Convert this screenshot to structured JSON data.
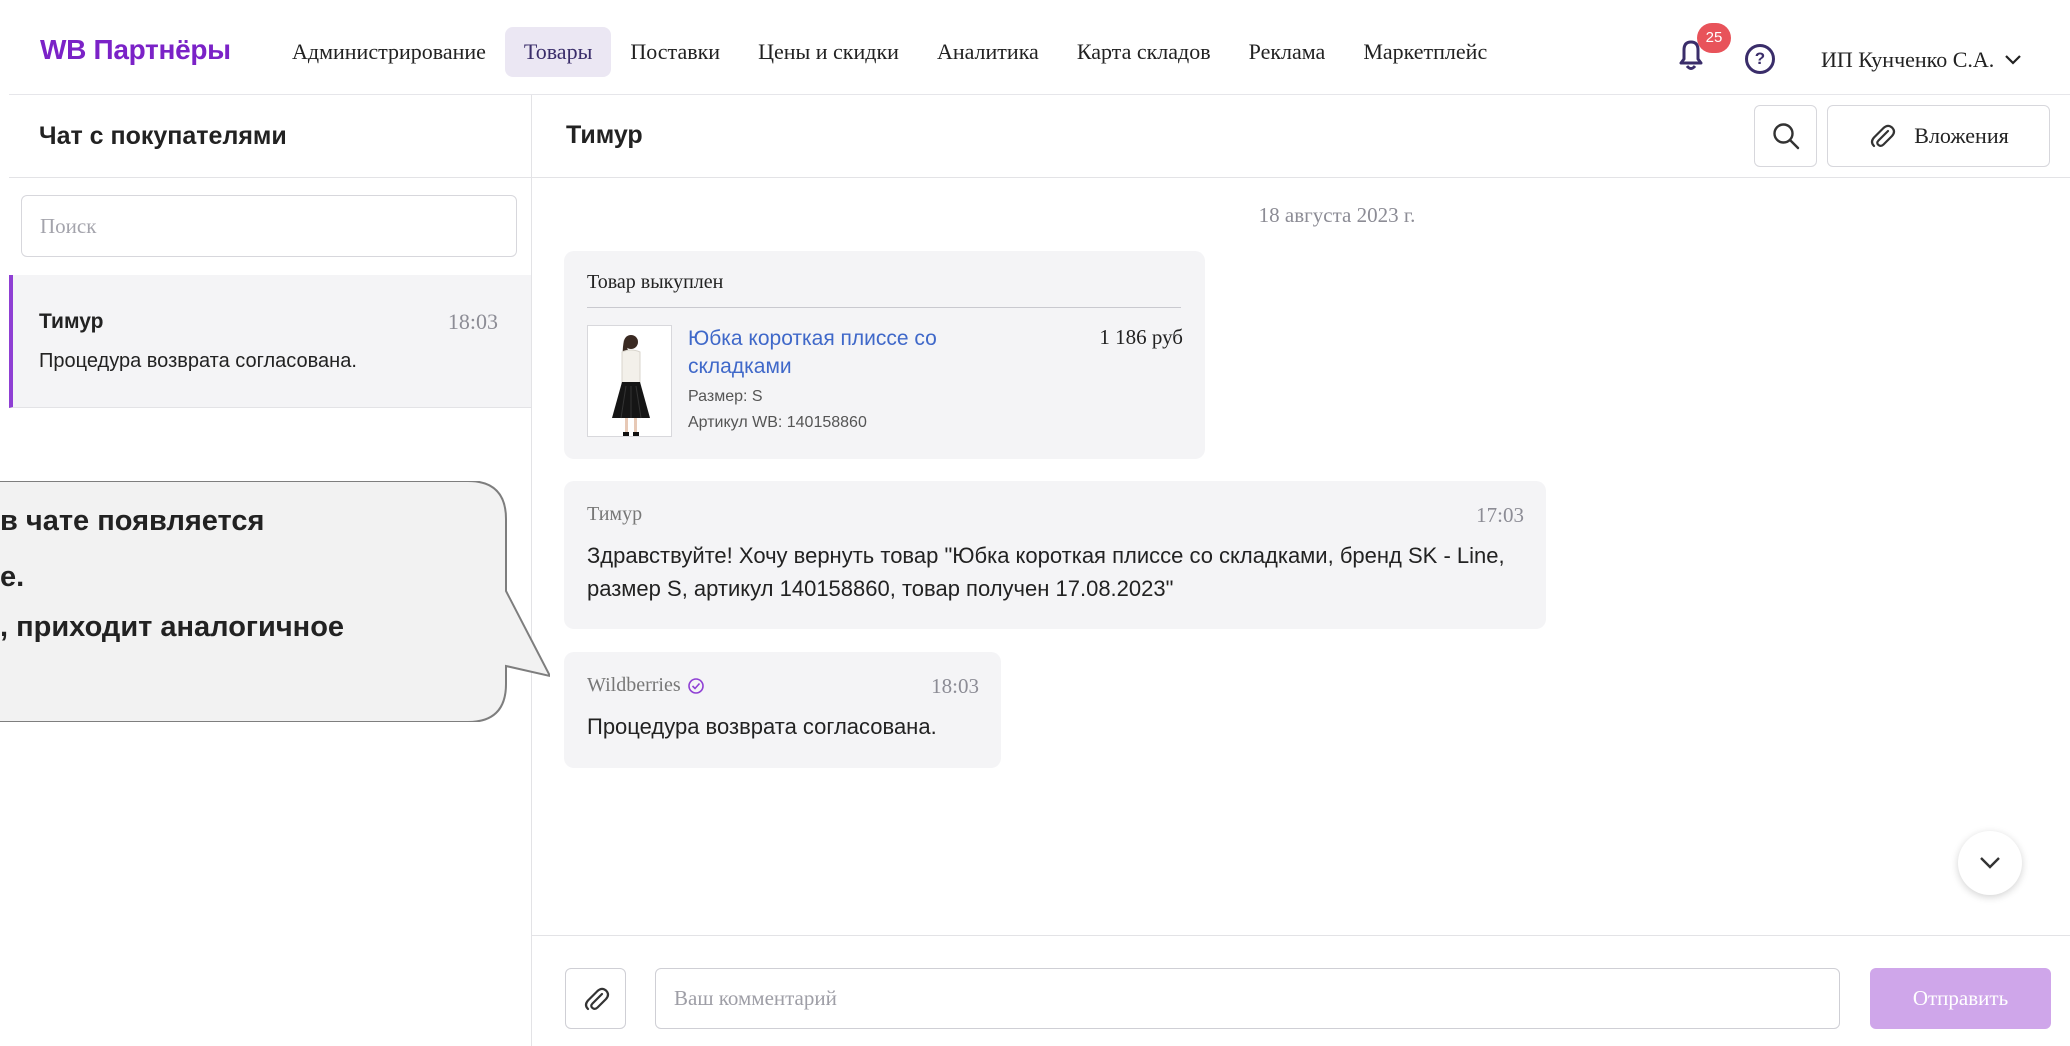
{
  "nav": {
    "logo": "WB Партнёры",
    "items": [
      {
        "label": "Администрирование",
        "active": false
      },
      {
        "label": "Товары",
        "active": true
      },
      {
        "label": "Поставки",
        "active": false
      },
      {
        "label": "Цены и скидки",
        "active": false
      },
      {
        "label": "Аналитика",
        "active": false
      },
      {
        "label": "Карта складов",
        "active": false
      },
      {
        "label": "Реклама",
        "active": false
      },
      {
        "label": "Маркетплейс",
        "active": false
      }
    ],
    "notifications_count": "25",
    "help_symbol": "?",
    "user": "ИП Кунченко С.А.",
    "icons": {
      "bell": "bell-icon",
      "help": "help-icon",
      "chevron": "chevron-down-icon"
    }
  },
  "sidebar": {
    "title": "Чат с покупателями",
    "search_placeholder": "Поиск",
    "chats": [
      {
        "name": "Тимур",
        "time": "18:03",
        "preview": "Процедура возврата согласована."
      }
    ]
  },
  "chat": {
    "title": "Тимур",
    "attachments_label": "Вложения",
    "date": "18 августа 2023 г.",
    "product": {
      "status": "Товар выкуплен",
      "title": "Юбка короткая плиссе со складками",
      "size": "Размер: S",
      "article": "Артикул WB: 140158860",
      "price": "1 186 руб"
    },
    "messages": [
      {
        "author": "Тимур",
        "time": "17:03",
        "text": "Здравствуйте! Хочу вернуть товар \"Юбка короткая плиссе со складками, бренд SK - Line, размер S, артикул 140158860, товар получен 17.08.2023\""
      },
      {
        "author": "Wildberries",
        "time": "18:03",
        "text": "Процедура возврата согласована.",
        "verified": true
      }
    ]
  },
  "composer": {
    "placeholder": "Ваш комментарий",
    "send_label": "Отправить"
  },
  "callout": {
    "lines": [
      "в чате появляется",
      "е.",
      ", приходит аналогичное"
    ]
  },
  "colors": {
    "brand": "#7b22c7",
    "active_nav_bg": "#ebe7f3",
    "link": "#3f68c9",
    "send_button": "#cfa6ea",
    "badge": "#e8535a"
  }
}
